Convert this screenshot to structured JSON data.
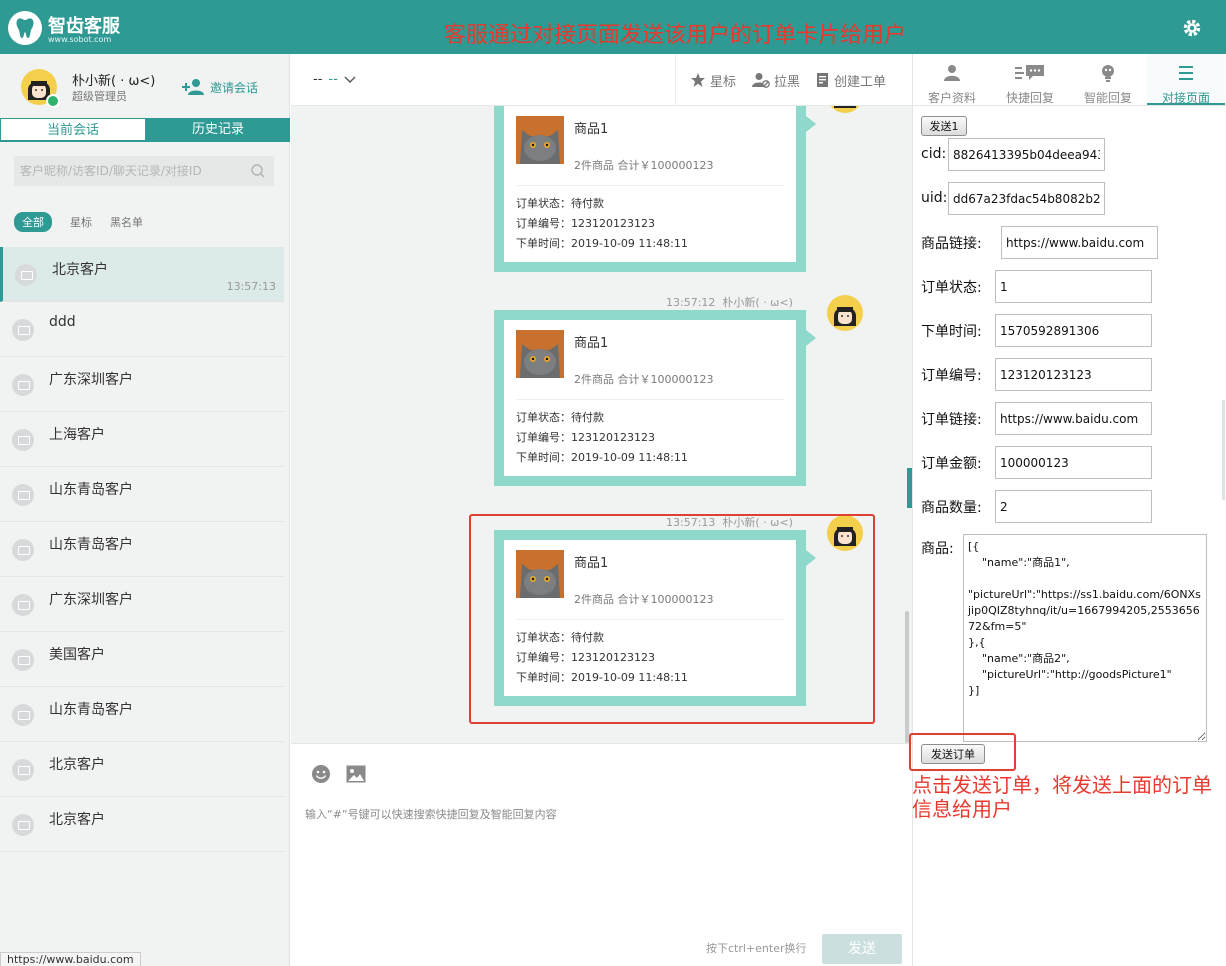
{
  "brand": {
    "name": "智齿客服",
    "url": "www.sobot.com"
  },
  "banner": "客服通过对接页面发送该用户的订单卡片给用户",
  "agent": {
    "name": "朴小新( · ω<)",
    "role": "超级管理员",
    "invite_label": "邀请会话"
  },
  "left_tabs": {
    "current": "当前会话",
    "history": "历史记录"
  },
  "search": {
    "placeholder": "客户昵称/访客ID/聊天记录/对接ID"
  },
  "filters": {
    "all": "全部",
    "star": "星标",
    "black": "黑名单"
  },
  "sessions": [
    {
      "name": "北京客户",
      "time": "13:57:13"
    },
    {
      "name": "ddd",
      "time": ""
    },
    {
      "name": "广东深圳客户",
      "time": ""
    },
    {
      "name": "上海客户",
      "time": ""
    },
    {
      "name": "山东青岛客户",
      "time": ""
    },
    {
      "name": "山东青岛客户",
      "time": ""
    },
    {
      "name": "广东深圳客户",
      "time": ""
    },
    {
      "name": "美国客户",
      "time": ""
    },
    {
      "name": "山东青岛客户",
      "time": ""
    },
    {
      "name": "北京客户",
      "time": ""
    },
    {
      "name": "北京客户",
      "time": ""
    }
  ],
  "status_url": "https://www.baidu.com",
  "chat_header": {
    "sel_left": "--",
    "sel_right": "--",
    "star": "星标",
    "black": "拉黑",
    "ticket": "创建工单"
  },
  "messages": [
    {
      "time": "",
      "sender": "",
      "product": "商品1",
      "summary": "2件商品 合计￥100000123",
      "status": "订单状态：待付款",
      "no": "订单编号：123120123123",
      "date": "下单时间：2019-10-09 11:48:11"
    },
    {
      "time": "13:57:12",
      "sender": "朴小新( · ω<)",
      "product": "商品1",
      "summary": "2件商品 合计￥100000123",
      "status": "订单状态：待付款",
      "no": "订单编号：123120123123",
      "date": "下单时间：2019-10-09 11:48:11"
    },
    {
      "time": "13:57:13",
      "sender": "朴小新( · ω<)",
      "product": "商品1",
      "summary": "2件商品 合计￥100000123",
      "status": "订单状态：待付款",
      "no": "订单编号：123120123123",
      "date": "下单时间：2019-10-09 11:48:11"
    }
  ],
  "composer": {
    "placeholder": "输入“#”号键可以快速搜索快捷回复及智能回复内容",
    "hint": "按下ctrl+enter换行",
    "send": "发送"
  },
  "right_tabs": [
    {
      "label": "客户资料",
      "icon": "person-icon"
    },
    {
      "label": "快捷回复",
      "icon": "quick-reply-icon"
    },
    {
      "label": "智能回复",
      "icon": "robot-icon"
    },
    {
      "label": "对接页面",
      "icon": "menu-lines-icon"
    }
  ],
  "form": {
    "send1": "发送1",
    "cid_label": "cid:",
    "cid": "8826413395b04deea943",
    "uid_label": "uid:",
    "uid": "dd67a23fdac54b8082b2c",
    "link_label": "商品链接:",
    "link": "https://www.baidu.com",
    "status_label": "订单状态:",
    "status": "1",
    "time_label": "下单时间:",
    "time": "1570592891306",
    "no_label": "订单编号:",
    "no": "123120123123",
    "olink_label": "订单链接:",
    "olink": "https://www.baidu.com",
    "amount_label": "订单金额:",
    "amount": "100000123",
    "qty_label": "商品数量:",
    "qty": "2",
    "goods_label": "商品:",
    "goods": "[{\n    \"name\":\"商品1\",\n\n\"pictureUrl\":\"https://ss1.baidu.com/6ONXsjip0QIZ8tyhnq/it/u=1667994205,255365672&fm=5\"\n},{\n    \"name\":\"商品2\",\n    \"pictureUrl\":\"http://goodsPicture1\"\n}]",
    "send_order": "发送订单"
  },
  "note": "点击发送订单，将发送上面的订单信息给用户",
  "colors": {
    "brand": "#2e9a93",
    "bubble": "#8ed8cc",
    "annotation": "#e8392e"
  }
}
